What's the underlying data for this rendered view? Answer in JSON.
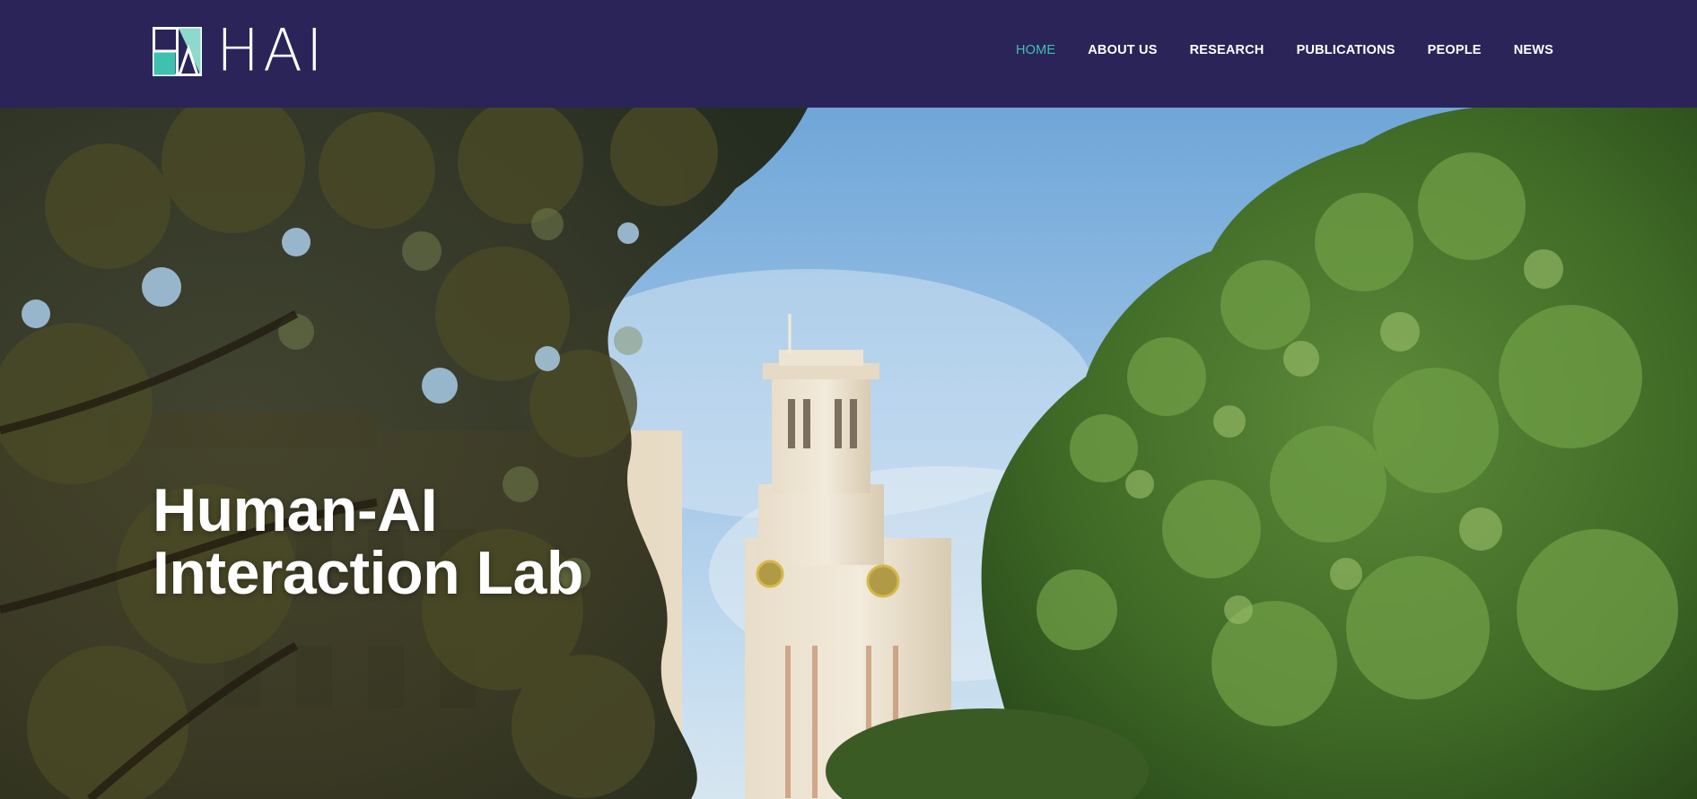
{
  "brand": {
    "logo_text": "HAI",
    "logo_icon": "hai-logo-mark",
    "colors": {
      "header_bg": "#2a2459",
      "accent": "#3fc1b0",
      "nav_text": "#ffffff"
    }
  },
  "nav": {
    "items": [
      {
        "label": "HOME",
        "active": true
      },
      {
        "label": "ABOUT US",
        "active": false
      },
      {
        "label": "RESEARCH",
        "active": false
      },
      {
        "label": "PUBLICATIONS",
        "active": false
      },
      {
        "label": "PEOPLE",
        "active": false
      },
      {
        "label": "NEWS",
        "active": false
      }
    ]
  },
  "hero": {
    "title_line1": "Human-AI",
    "title_line2": "Interaction Lab",
    "background": "campus-tower-through-trees-photo"
  }
}
